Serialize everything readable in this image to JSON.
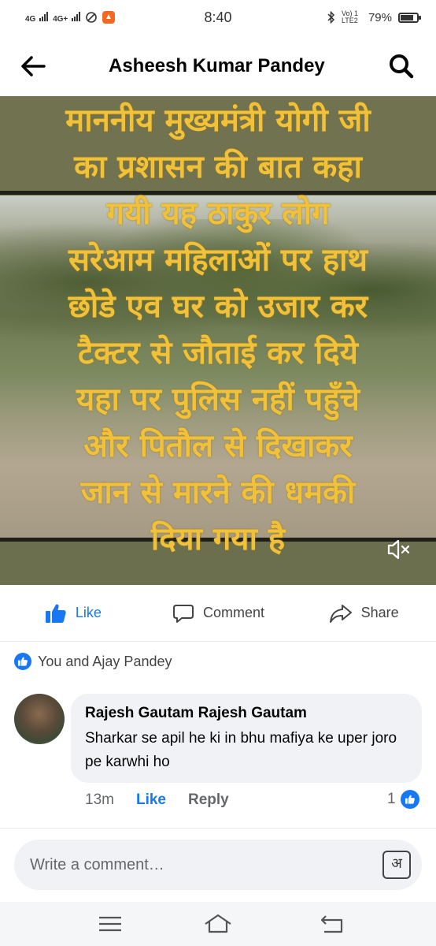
{
  "status_bar": {
    "network_1": "4G",
    "network_2": "4G+",
    "time": "8:40",
    "volte": "Vo) 1 LTE2",
    "battery_text": "79%",
    "battery_level": 0.79
  },
  "header": {
    "back_icon": "arrow-left-icon",
    "title": "Asheesh Kumar Pandey",
    "search_icon": "search-icon"
  },
  "video": {
    "overlay_text": "माननीय मुख्यमंत्री योगी जी\nका प्रशासन की बात कहा\nगयी यह ठाकुर लोग\nसरेआम महिलाओं पर हाथ\nछोडे एव घर को उजार कर\nटैक्टर से जौताई कर दिये\nयहा पर पुलिस नहीं पहुँचे\nऔर पितौल से दिखाकर\nजान से मारने की धमकी\nदिया गया है",
    "mute_icon": "volume-mute-icon"
  },
  "actions": {
    "like_label": "Like",
    "comment_label": "Comment",
    "share_label": "Share"
  },
  "reactions": {
    "summary": "You and Ajay Pandey"
  },
  "comment": {
    "author": "Rajesh Gautam Rajesh Gautam",
    "text": "Sharkar se apil he ki in bhu mafiya ke uper joro pe karwhi ho",
    "time": "13m",
    "like_label": "Like",
    "reply_label": "Reply",
    "reaction_count": "1"
  },
  "composer": {
    "placeholder": "Write a comment…",
    "keyboard_label": "अ"
  },
  "colors": {
    "accent": "#1877f2",
    "overlay_text": "#f2c13a",
    "bubble": "#f0f2f5"
  }
}
